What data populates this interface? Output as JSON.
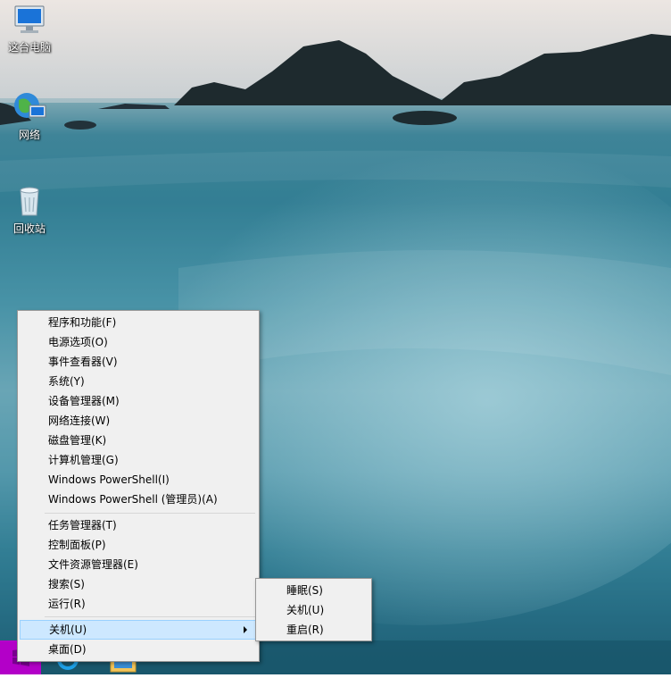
{
  "desktop_icons": [
    {
      "label": "这台电脑",
      "icon": "computer-icon"
    },
    {
      "label": "网络",
      "icon": "network-icon"
    },
    {
      "label": "回收站",
      "icon": "recycle-bin-icon"
    }
  ],
  "context_menu": {
    "items": [
      {
        "label": "程序和功能(F)"
      },
      {
        "label": "电源选项(O)"
      },
      {
        "label": "事件查看器(V)"
      },
      {
        "label": "系统(Y)"
      },
      {
        "label": "设备管理器(M)"
      },
      {
        "label": "网络连接(W)"
      },
      {
        "label": "磁盘管理(K)"
      },
      {
        "label": "计算机管理(G)"
      },
      {
        "label": "Windows PowerShell(I)"
      },
      {
        "label": "Windows PowerShell (管理员)(A)"
      },
      {
        "label": "任务管理器(T)"
      },
      {
        "label": "控制面板(P)"
      },
      {
        "label": "文件资源管理器(E)"
      },
      {
        "label": "搜索(S)"
      },
      {
        "label": "运行(R)"
      },
      {
        "label": "关机(U)"
      },
      {
        "label": "桌面(D)"
      }
    ]
  },
  "shutdown_submenu": {
    "items": [
      {
        "label": "睡眠(S)"
      },
      {
        "label": "关机(U)"
      },
      {
        "label": "重启(R)"
      }
    ]
  },
  "taskbar": {
    "apps": [
      "start-button",
      "ie-icon",
      "file-explorer-icon"
    ],
    "start_color": "#b300c8",
    "highlight_color": "#cde8ff"
  }
}
